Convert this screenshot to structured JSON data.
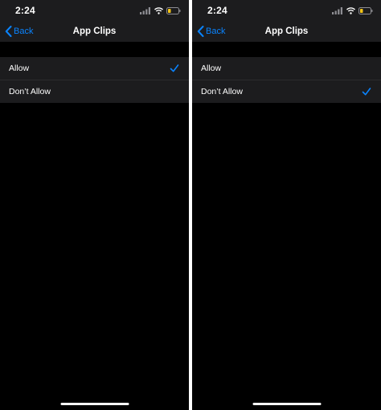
{
  "screens": [
    {
      "status": {
        "time": "2:24",
        "battery_color": "#f5c518"
      },
      "nav": {
        "back_label": "Back",
        "title": "App Clips"
      },
      "options": [
        {
          "label": "Allow",
          "selected": true
        },
        {
          "label": "Don’t Allow",
          "selected": false
        }
      ]
    },
    {
      "status": {
        "time": "2:24",
        "battery_color": "#f5c518"
      },
      "nav": {
        "back_label": "Back",
        "title": "App Clips"
      },
      "options": [
        {
          "label": "Allow",
          "selected": false
        },
        {
          "label": "Don’t Allow",
          "selected": true
        }
      ]
    }
  ],
  "colors": {
    "accent": "#0a84ff",
    "background": "#000000",
    "cell": "#1c1c1e"
  }
}
